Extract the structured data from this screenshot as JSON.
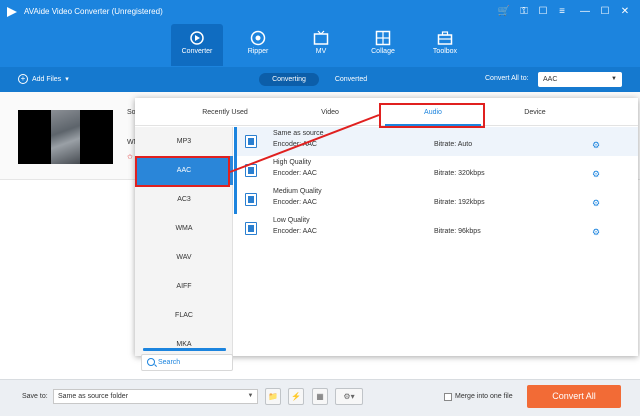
{
  "app": {
    "title": "AVAide Video Converter (Unregistered)"
  },
  "window_controls": [
    {
      "name": "cart-icon",
      "glyph": "🛒"
    },
    {
      "name": "key-icon",
      "glyph": "⚿"
    },
    {
      "name": "feedback-icon",
      "glyph": "☐"
    },
    {
      "name": "menu-icon",
      "glyph": "≡"
    },
    {
      "name": "minimize-icon",
      "glyph": "—"
    },
    {
      "name": "maximize-icon",
      "glyph": "☐"
    },
    {
      "name": "close-icon",
      "glyph": "✕"
    }
  ],
  "nav": {
    "tabs": [
      {
        "label": "Converter",
        "icon": "converter-icon",
        "active": true
      },
      {
        "label": "Ripper",
        "icon": "disc-icon",
        "active": false
      },
      {
        "label": "MV",
        "icon": "tv-icon",
        "active": false
      },
      {
        "label": "Collage",
        "icon": "collage-icon",
        "active": false
      },
      {
        "label": "Toolbox",
        "icon": "toolbox-icon",
        "active": false
      }
    ]
  },
  "toolbar": {
    "add_files": "Add Files",
    "segments": [
      "Converting",
      "Converted"
    ],
    "convert_all_label": "Convert All to:",
    "convert_all_value": "AAC"
  },
  "file": {
    "name_fragment": "So",
    "format_fragment": "WM"
  },
  "format_panel": {
    "tabs": [
      "Recently Used",
      "Video",
      "Audio",
      "Device"
    ],
    "active_tab": "Audio",
    "formats": [
      "MP3",
      "AAC",
      "AC3",
      "WMA",
      "WAV",
      "AIFF",
      "FLAC",
      "MKA"
    ],
    "active_format": "AAC",
    "search_label": "Search",
    "presets": [
      {
        "name": "Same as source",
        "encoder": "Encoder: AAC",
        "bitrate": "Bitrate: Auto"
      },
      {
        "name": "High Quality",
        "encoder": "Encoder: AAC",
        "bitrate": "Bitrate: 320kbps"
      },
      {
        "name": "Medium Quality",
        "encoder": "Encoder: AAC",
        "bitrate": "Bitrate: 192kbps"
      },
      {
        "name": "Low Quality",
        "encoder": "Encoder: AAC",
        "bitrate": "Bitrate: 96kbps"
      }
    ]
  },
  "bottom": {
    "save_to_label": "Save to:",
    "save_to_value": "Same as source folder",
    "merge_label": "Merge into one file",
    "convert_all_button": "Convert All"
  },
  "colors": {
    "header_blue": "#1c84de",
    "accent_orange": "#f26b36",
    "annotation_red": "#e0201f"
  }
}
